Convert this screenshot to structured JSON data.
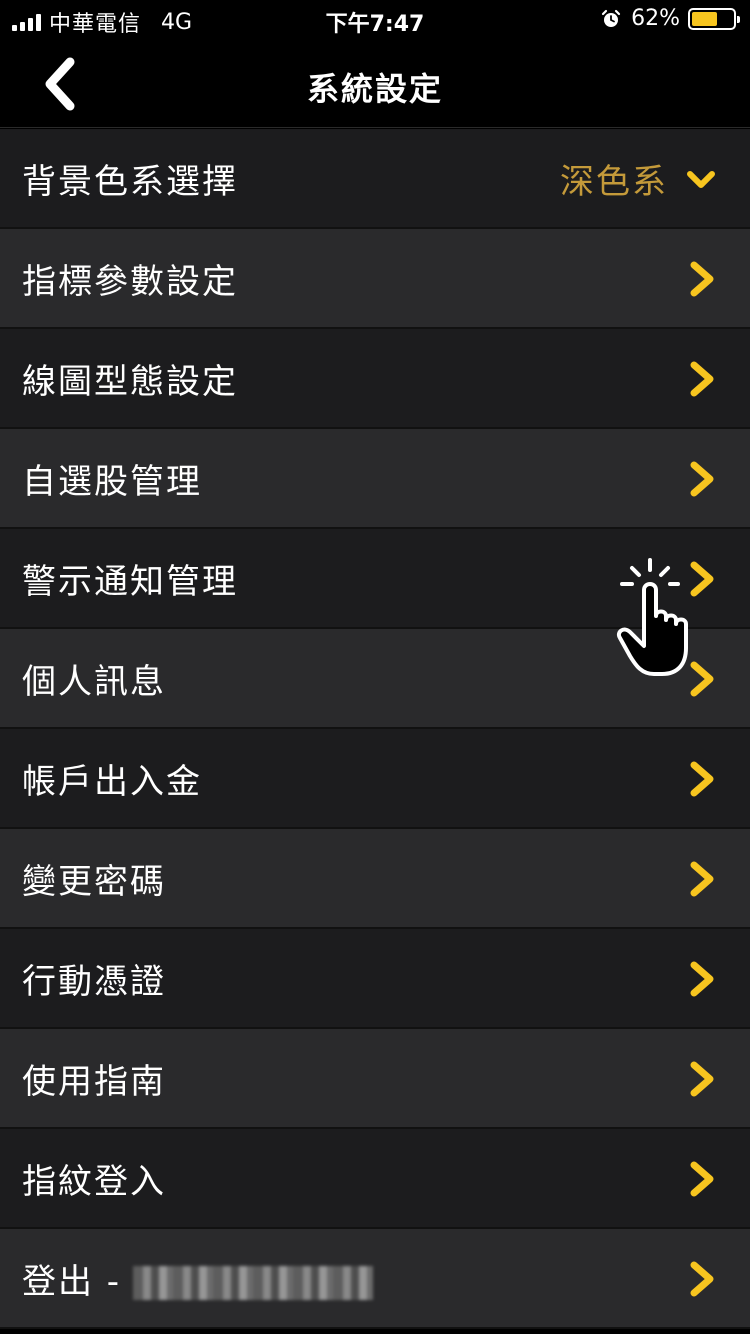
{
  "status": {
    "carrier": "中華電信",
    "network": "4G",
    "time": "下午7:47",
    "battery_percent_text": "62%",
    "battery_level": 0.62,
    "battery_color": "#f7c51f"
  },
  "header": {
    "title": "系統設定",
    "back_icon": "chevron-left-icon"
  },
  "theme": {
    "accent": "#f7c51f",
    "value_color": "#c49a3a"
  },
  "settings": {
    "items": [
      {
        "label": "背景色系選擇",
        "value": "深色系",
        "icon": "chevron-down-icon"
      },
      {
        "label": "指標參數設定",
        "icon": "chevron-right-icon"
      },
      {
        "label": "線圖型態設定",
        "icon": "chevron-right-icon"
      },
      {
        "label": "自選股管理",
        "icon": "chevron-right-icon"
      },
      {
        "label": "警示通知管理",
        "icon": "chevron-right-icon"
      },
      {
        "label": "個人訊息",
        "icon": "chevron-right-icon"
      },
      {
        "label": "帳戶出入金",
        "icon": "chevron-right-icon"
      },
      {
        "label": "變更密碼",
        "icon": "chevron-right-icon"
      },
      {
        "label": "行動憑證",
        "icon": "chevron-right-icon"
      },
      {
        "label": "使用指南",
        "icon": "chevron-right-icon"
      },
      {
        "label": "指紋登入",
        "icon": "chevron-right-icon"
      },
      {
        "label": "登出 -",
        "icon": "chevron-right-icon"
      }
    ]
  }
}
